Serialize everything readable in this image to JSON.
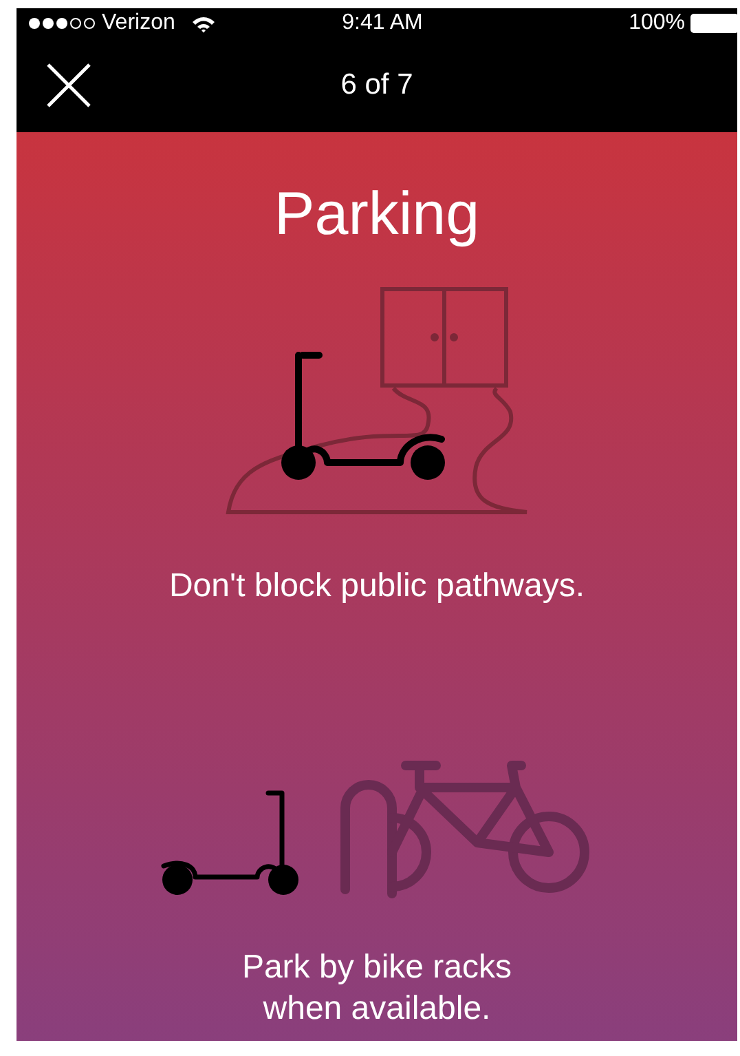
{
  "status_bar": {
    "carrier": "Verizon",
    "time": "9:41 AM",
    "battery": "100%"
  },
  "nav_bar": {
    "title": "6 of 7"
  },
  "heading": "Parking",
  "tips": [
    {
      "kind": "pathway",
      "text": "Don't block public pathways."
    },
    {
      "kind": "bike-rack",
      "text": "Park by bike racks when available."
    }
  ]
}
